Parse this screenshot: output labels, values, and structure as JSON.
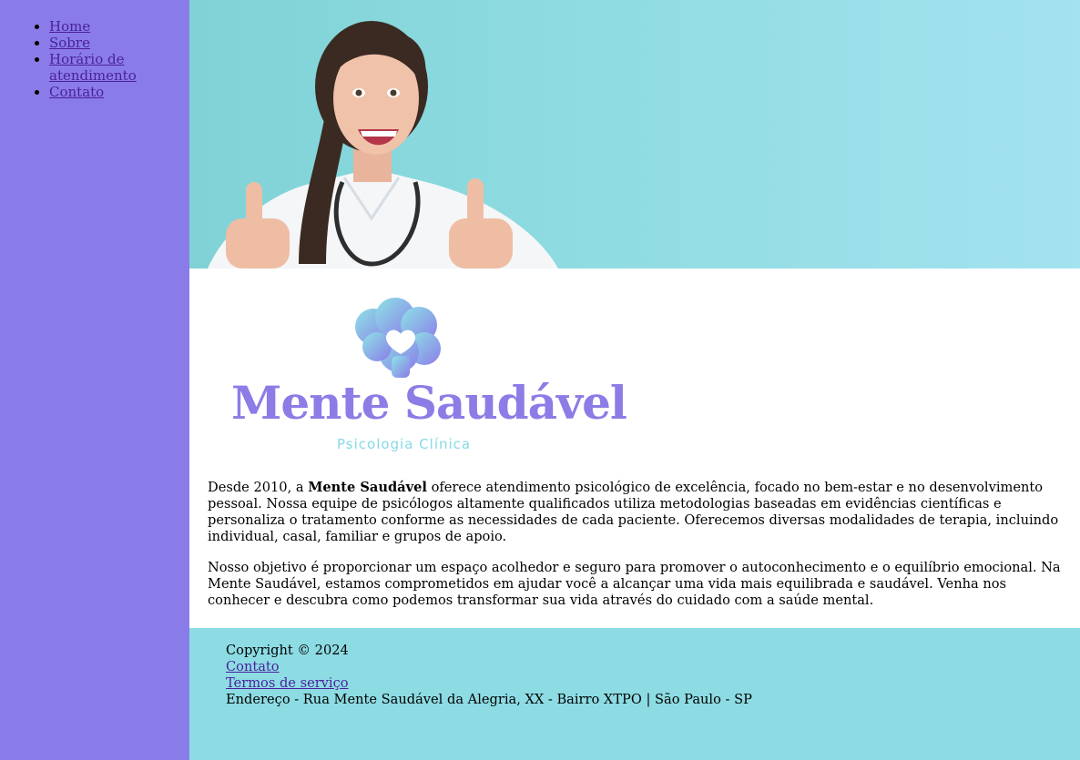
{
  "nav": {
    "items": [
      {
        "label": "Home"
      },
      {
        "label": "Sobre"
      },
      {
        "label": "Horário de atendimento"
      },
      {
        "label": "Contato"
      }
    ]
  },
  "hero": {
    "icon": "doctor-thumbs-up-photo",
    "colors": {
      "background": "#8fdce2"
    }
  },
  "logo": {
    "title": "Mente Saudável",
    "subtitle": "Psicologia Clínica",
    "icon": "brain-heart-icon",
    "colors": {
      "title": "#8c7ce6",
      "subtitle": "#86d9e8"
    }
  },
  "intro": {
    "p1_before": "Desde 2010, a ",
    "p1_bold": "Mente Saudável",
    "p1_after": " oferece atendimento psicológico de excelência, focado no bem-estar e no desenvolvimento pessoal. Nossa equipe de psicólogos altamente qualificados utiliza metodologias baseadas em evidências científicas e personaliza o tratamento conforme as necessidades de cada paciente. Oferecemos diversas modalidades de terapia, incluindo individual, casal, familiar e grupos de apoio.",
    "p2": "Nosso objetivo é proporcionar um espaço acolhedor e seguro para promover o autoconhecimento e o equilíbrio emocional. Na Mente Saudável, estamos comprometidos em ajudar você a alcançar uma vida mais equilibrada e saudável. Venha nos conhecer e descubra como podemos transformar sua vida através do cuidado com a saúde mental."
  },
  "footer": {
    "copyright": "Copyright © 2024",
    "contact_link": "Contato",
    "terms_link": "Termos de serviço",
    "address": "Endereço - Rua Mente Saudável da Alegria, XX - Bairro XTPO | São Paulo - SP"
  },
  "colors": {
    "sidebar": "#8a7ce8",
    "footer": "#8ddce4",
    "link": "#4b1f9c"
  }
}
